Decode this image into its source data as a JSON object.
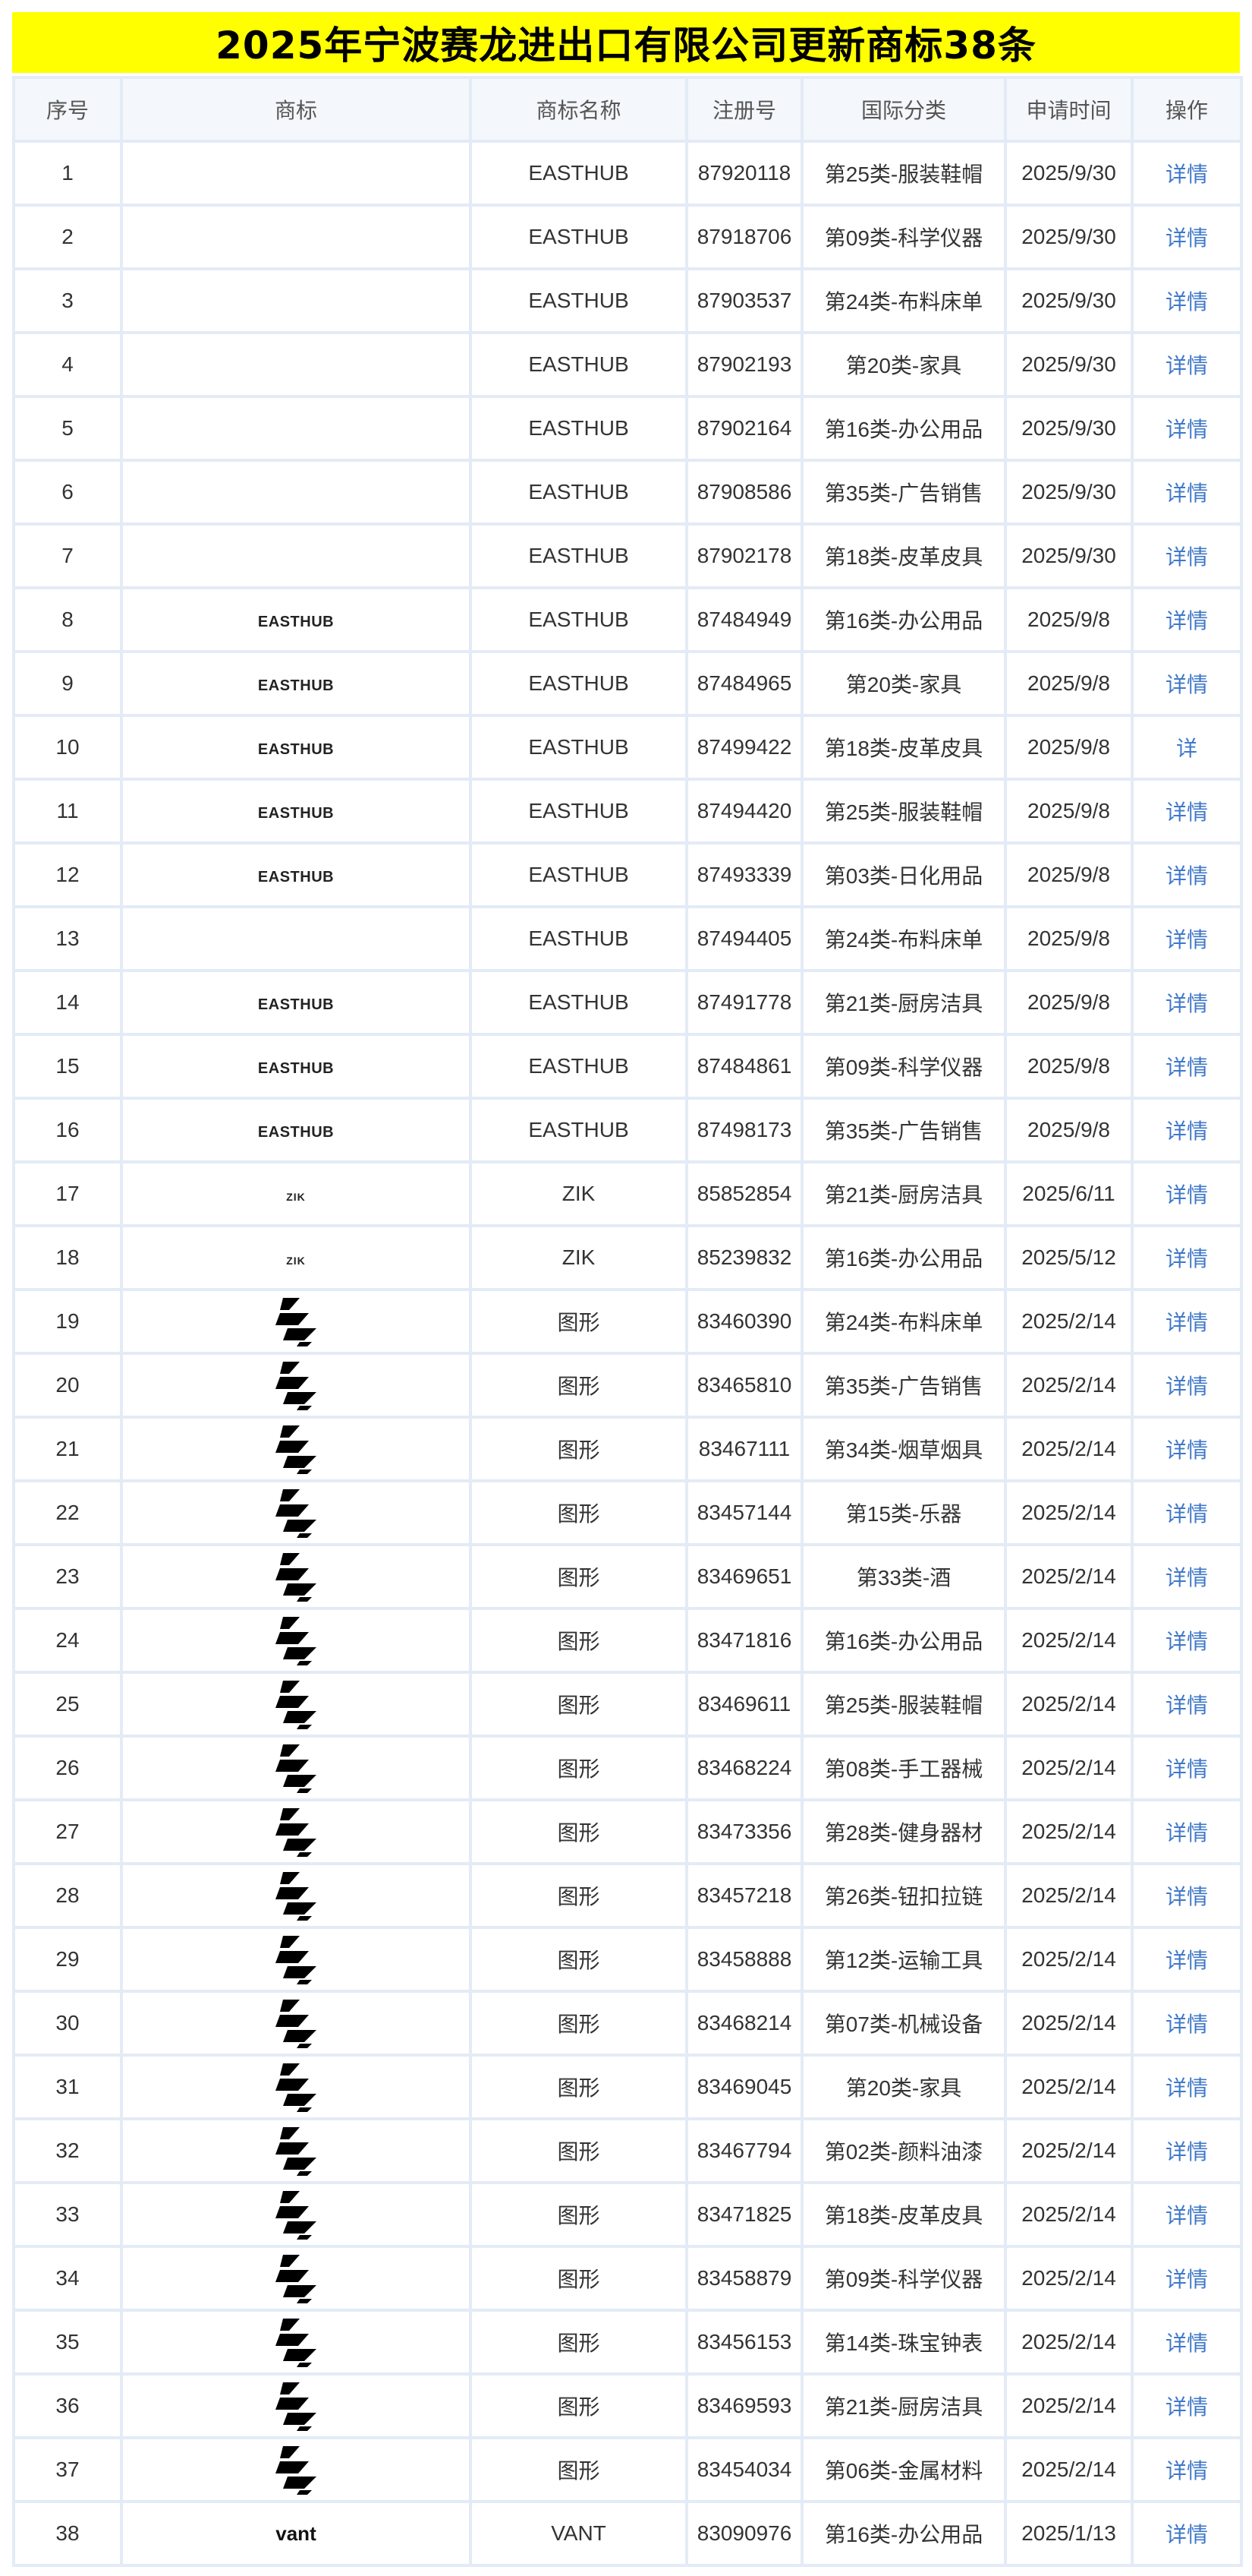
{
  "title": "2025年宁波赛龙进出口有限公司更新商标38条",
  "headers": [
    "序号",
    "商标",
    "商标名称",
    "注册号",
    "国际分类",
    "申请时间",
    "操作"
  ],
  "rows": [
    {
      "no": "1",
      "logo": "",
      "logo_type": "none",
      "name": "EASTHUB",
      "reg": "87920118",
      "cls": "第25类-服装鞋帽",
      "date": "2025/9/30",
      "op": "详情"
    },
    {
      "no": "2",
      "logo": "",
      "logo_type": "none",
      "name": "EASTHUB",
      "reg": "87918706",
      "cls": "第09类-科学仪器",
      "date": "2025/9/30",
      "op": "详情"
    },
    {
      "no": "3",
      "logo": "",
      "logo_type": "none",
      "name": "EASTHUB",
      "reg": "87903537",
      "cls": "第24类-布料床单",
      "date": "2025/9/30",
      "op": "详情"
    },
    {
      "no": "4",
      "logo": "",
      "logo_type": "none",
      "name": "EASTHUB",
      "reg": "87902193",
      "cls": "第20类-家具",
      "date": "2025/9/30",
      "op": "详情"
    },
    {
      "no": "5",
      "logo": "",
      "logo_type": "none",
      "name": "EASTHUB",
      "reg": "87902164",
      "cls": "第16类-办公用品",
      "date": "2025/9/30",
      "op": "详情"
    },
    {
      "no": "6",
      "logo": "",
      "logo_type": "none",
      "name": "EASTHUB",
      "reg": "87908586",
      "cls": "第35类-广告销售",
      "date": "2025/9/30",
      "op": "详情"
    },
    {
      "no": "7",
      "logo": "",
      "logo_type": "none",
      "name": "EASTHUB",
      "reg": "87902178",
      "cls": "第18类-皮革皮具",
      "date": "2025/9/30",
      "op": "详情"
    },
    {
      "no": "8",
      "logo": "EASTHUB",
      "logo_type": "text",
      "name": "EASTHUB",
      "reg": "87484949",
      "cls": "第16类-办公用品",
      "date": "2025/9/8",
      "op": "详情"
    },
    {
      "no": "9",
      "logo": "EASTHUB",
      "logo_type": "text",
      "name": "EASTHUB",
      "reg": "87484965",
      "cls": "第20类-家具",
      "date": "2025/9/8",
      "op": "详情"
    },
    {
      "no": "10",
      "logo": "EASTHUB",
      "logo_type": "text",
      "name": "EASTHUB",
      "reg": "87499422",
      "cls": "第18类-皮革皮具",
      "date": "2025/9/8",
      "op": "详"
    },
    {
      "no": "11",
      "logo": "EASTHUB",
      "logo_type": "text",
      "name": "EASTHUB",
      "reg": "87494420",
      "cls": "第25类-服装鞋帽",
      "date": "2025/9/8",
      "op": "详情"
    },
    {
      "no": "12",
      "logo": "EASTHUB",
      "logo_type": "text",
      "name": "EASTHUB",
      "reg": "87493339",
      "cls": "第03类-日化用品",
      "date": "2025/9/8",
      "op": "详情"
    },
    {
      "no": "13",
      "logo": "",
      "logo_type": "none",
      "name": "EASTHUB",
      "reg": "87494405",
      "cls": "第24类-布料床单",
      "date": "2025/9/8",
      "op": "详情"
    },
    {
      "no": "14",
      "logo": "EASTHUB",
      "logo_type": "text",
      "name": "EASTHUB",
      "reg": "87491778",
      "cls": "第21类-厨房洁具",
      "date": "2025/9/8",
      "op": "详情"
    },
    {
      "no": "15",
      "logo": "EASTHUB",
      "logo_type": "text",
      "name": "EASTHUB",
      "reg": "87484861",
      "cls": "第09类-科学仪器",
      "date": "2025/9/8",
      "op": "详情"
    },
    {
      "no": "16",
      "logo": "EASTHUB",
      "logo_type": "text",
      "name": "EASTHUB",
      "reg": "87498173",
      "cls": "第35类-广告销售",
      "date": "2025/9/8",
      "op": "详情"
    },
    {
      "no": "17",
      "logo": "ZIK",
      "logo_type": "zik",
      "name": "ZIK",
      "reg": "85852854",
      "cls": "第21类-厨房洁具",
      "date": "2025/6/11",
      "op": "详情"
    },
    {
      "no": "18",
      "logo": "ZIK",
      "logo_type": "zik",
      "name": "ZIK",
      "reg": "85239832",
      "cls": "第16类-办公用品",
      "date": "2025/5/12",
      "op": "详情"
    },
    {
      "no": "19",
      "logo": "",
      "logo_type": "graphic",
      "name": "图形",
      "reg": "83460390",
      "cls": "第24类-布料床单",
      "date": "2025/2/14",
      "op": "详情"
    },
    {
      "no": "20",
      "logo": "",
      "logo_type": "graphic",
      "name": "图形",
      "reg": "83465810",
      "cls": "第35类-广告销售",
      "date": "2025/2/14",
      "op": "详情"
    },
    {
      "no": "21",
      "logo": "",
      "logo_type": "graphic",
      "name": "图形",
      "reg": "83467111",
      "cls": "第34类-烟草烟具",
      "date": "2025/2/14",
      "op": "详情"
    },
    {
      "no": "22",
      "logo": "",
      "logo_type": "graphic",
      "name": "图形",
      "reg": "83457144",
      "cls": "第15类-乐器",
      "date": "2025/2/14",
      "op": "详情"
    },
    {
      "no": "23",
      "logo": "",
      "logo_type": "graphic",
      "name": "图形",
      "reg": "83469651",
      "cls": "第33类-酒",
      "date": "2025/2/14",
      "op": "详情"
    },
    {
      "no": "24",
      "logo": "",
      "logo_type": "graphic",
      "name": "图形",
      "reg": "83471816",
      "cls": "第16类-办公用品",
      "date": "2025/2/14",
      "op": "详情"
    },
    {
      "no": "25",
      "logo": "",
      "logo_type": "graphic",
      "name": "图形",
      "reg": "83469611",
      "cls": "第25类-服装鞋帽",
      "date": "2025/2/14",
      "op": "详情"
    },
    {
      "no": "26",
      "logo": "",
      "logo_type": "graphic",
      "name": "图形",
      "reg": "83468224",
      "cls": "第08类-手工器械",
      "date": "2025/2/14",
      "op": "详情"
    },
    {
      "no": "27",
      "logo": "",
      "logo_type": "graphic",
      "name": "图形",
      "reg": "83473356",
      "cls": "第28类-健身器材",
      "date": "2025/2/14",
      "op": "详情"
    },
    {
      "no": "28",
      "logo": "",
      "logo_type": "graphic",
      "name": "图形",
      "reg": "83457218",
      "cls": "第26类-钮扣拉链",
      "date": "2025/2/14",
      "op": "详情"
    },
    {
      "no": "29",
      "logo": "",
      "logo_type": "graphic",
      "name": "图形",
      "reg": "83458888",
      "cls": "第12类-运输工具",
      "date": "2025/2/14",
      "op": "详情"
    },
    {
      "no": "30",
      "logo": "",
      "logo_type": "graphic",
      "name": "图形",
      "reg": "83468214",
      "cls": "第07类-机械设备",
      "date": "2025/2/14",
      "op": "详情"
    },
    {
      "no": "31",
      "logo": "",
      "logo_type": "graphic",
      "name": "图形",
      "reg": "83469045",
      "cls": "第20类-家具",
      "date": "2025/2/14",
      "op": "详情"
    },
    {
      "no": "32",
      "logo": "",
      "logo_type": "graphic",
      "name": "图形",
      "reg": "83467794",
      "cls": "第02类-颜料油漆",
      "date": "2025/2/14",
      "op": "详情"
    },
    {
      "no": "33",
      "logo": "",
      "logo_type": "graphic",
      "name": "图形",
      "reg": "83471825",
      "cls": "第18类-皮革皮具",
      "date": "2025/2/14",
      "op": "详情"
    },
    {
      "no": "34",
      "logo": "",
      "logo_type": "graphic",
      "name": "图形",
      "reg": "83458879",
      "cls": "第09类-科学仪器",
      "date": "2025/2/14",
      "op": "详情"
    },
    {
      "no": "35",
      "logo": "",
      "logo_type": "graphic",
      "name": "图形",
      "reg": "83456153",
      "cls": "第14类-珠宝钟表",
      "date": "2025/2/14",
      "op": "详情"
    },
    {
      "no": "36",
      "logo": "",
      "logo_type": "graphic",
      "name": "图形",
      "reg": "83469593",
      "cls": "第21类-厨房洁具",
      "date": "2025/2/14",
      "op": "详情"
    },
    {
      "no": "37",
      "logo": "",
      "logo_type": "graphic",
      "name": "图形",
      "reg": "83454034",
      "cls": "第06类-金属材料",
      "date": "2025/2/14",
      "op": "详情"
    },
    {
      "no": "38",
      "logo": "vant",
      "logo_type": "vant",
      "name": "VANT",
      "reg": "83090976",
      "cls": "第16类-办公用品",
      "date": "2025/1/13",
      "op": "详情"
    }
  ],
  "colors": {
    "title_bg": "#ffff00",
    "link": "#3f78c9",
    "border": "#e3ebf6",
    "header_bg": "#f4f7fb"
  },
  "icons": {
    "graphic_logo": "stripe-mark-icon"
  }
}
